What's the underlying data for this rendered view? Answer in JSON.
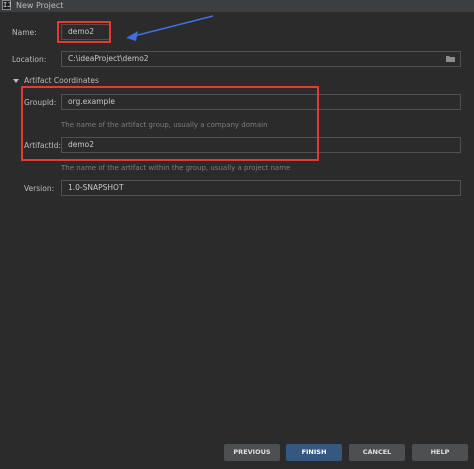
{
  "window": {
    "title": "New Project",
    "app_icon_glyph": "IJ"
  },
  "form": {
    "name": {
      "label": "Name:",
      "value": "demo2"
    },
    "location": {
      "label": "Location:",
      "value": "C:\\ideaProject\\demo2"
    },
    "section_title": "Artifact Coordinates",
    "group_id": {
      "label": "GroupId:",
      "value": "org.example",
      "hint": "The name of the artifact group, usually a company domain"
    },
    "artifact_id": {
      "label": "ArtifactId:",
      "value": "demo2",
      "hint": "The name of the artifact within the group, usually a project name"
    },
    "version": {
      "label": "Version:",
      "value": "1.0-SNAPSHOT"
    }
  },
  "buttons": {
    "previous": "PREVIOUS",
    "finish": "FINISH",
    "cancel": "CANCEL",
    "help": "HELP"
  },
  "colors": {
    "background": "#2b2b2b",
    "highlight_box": "#e53935",
    "annotation_arrow": "#3f6fe0",
    "primary_button": "#365880"
  }
}
